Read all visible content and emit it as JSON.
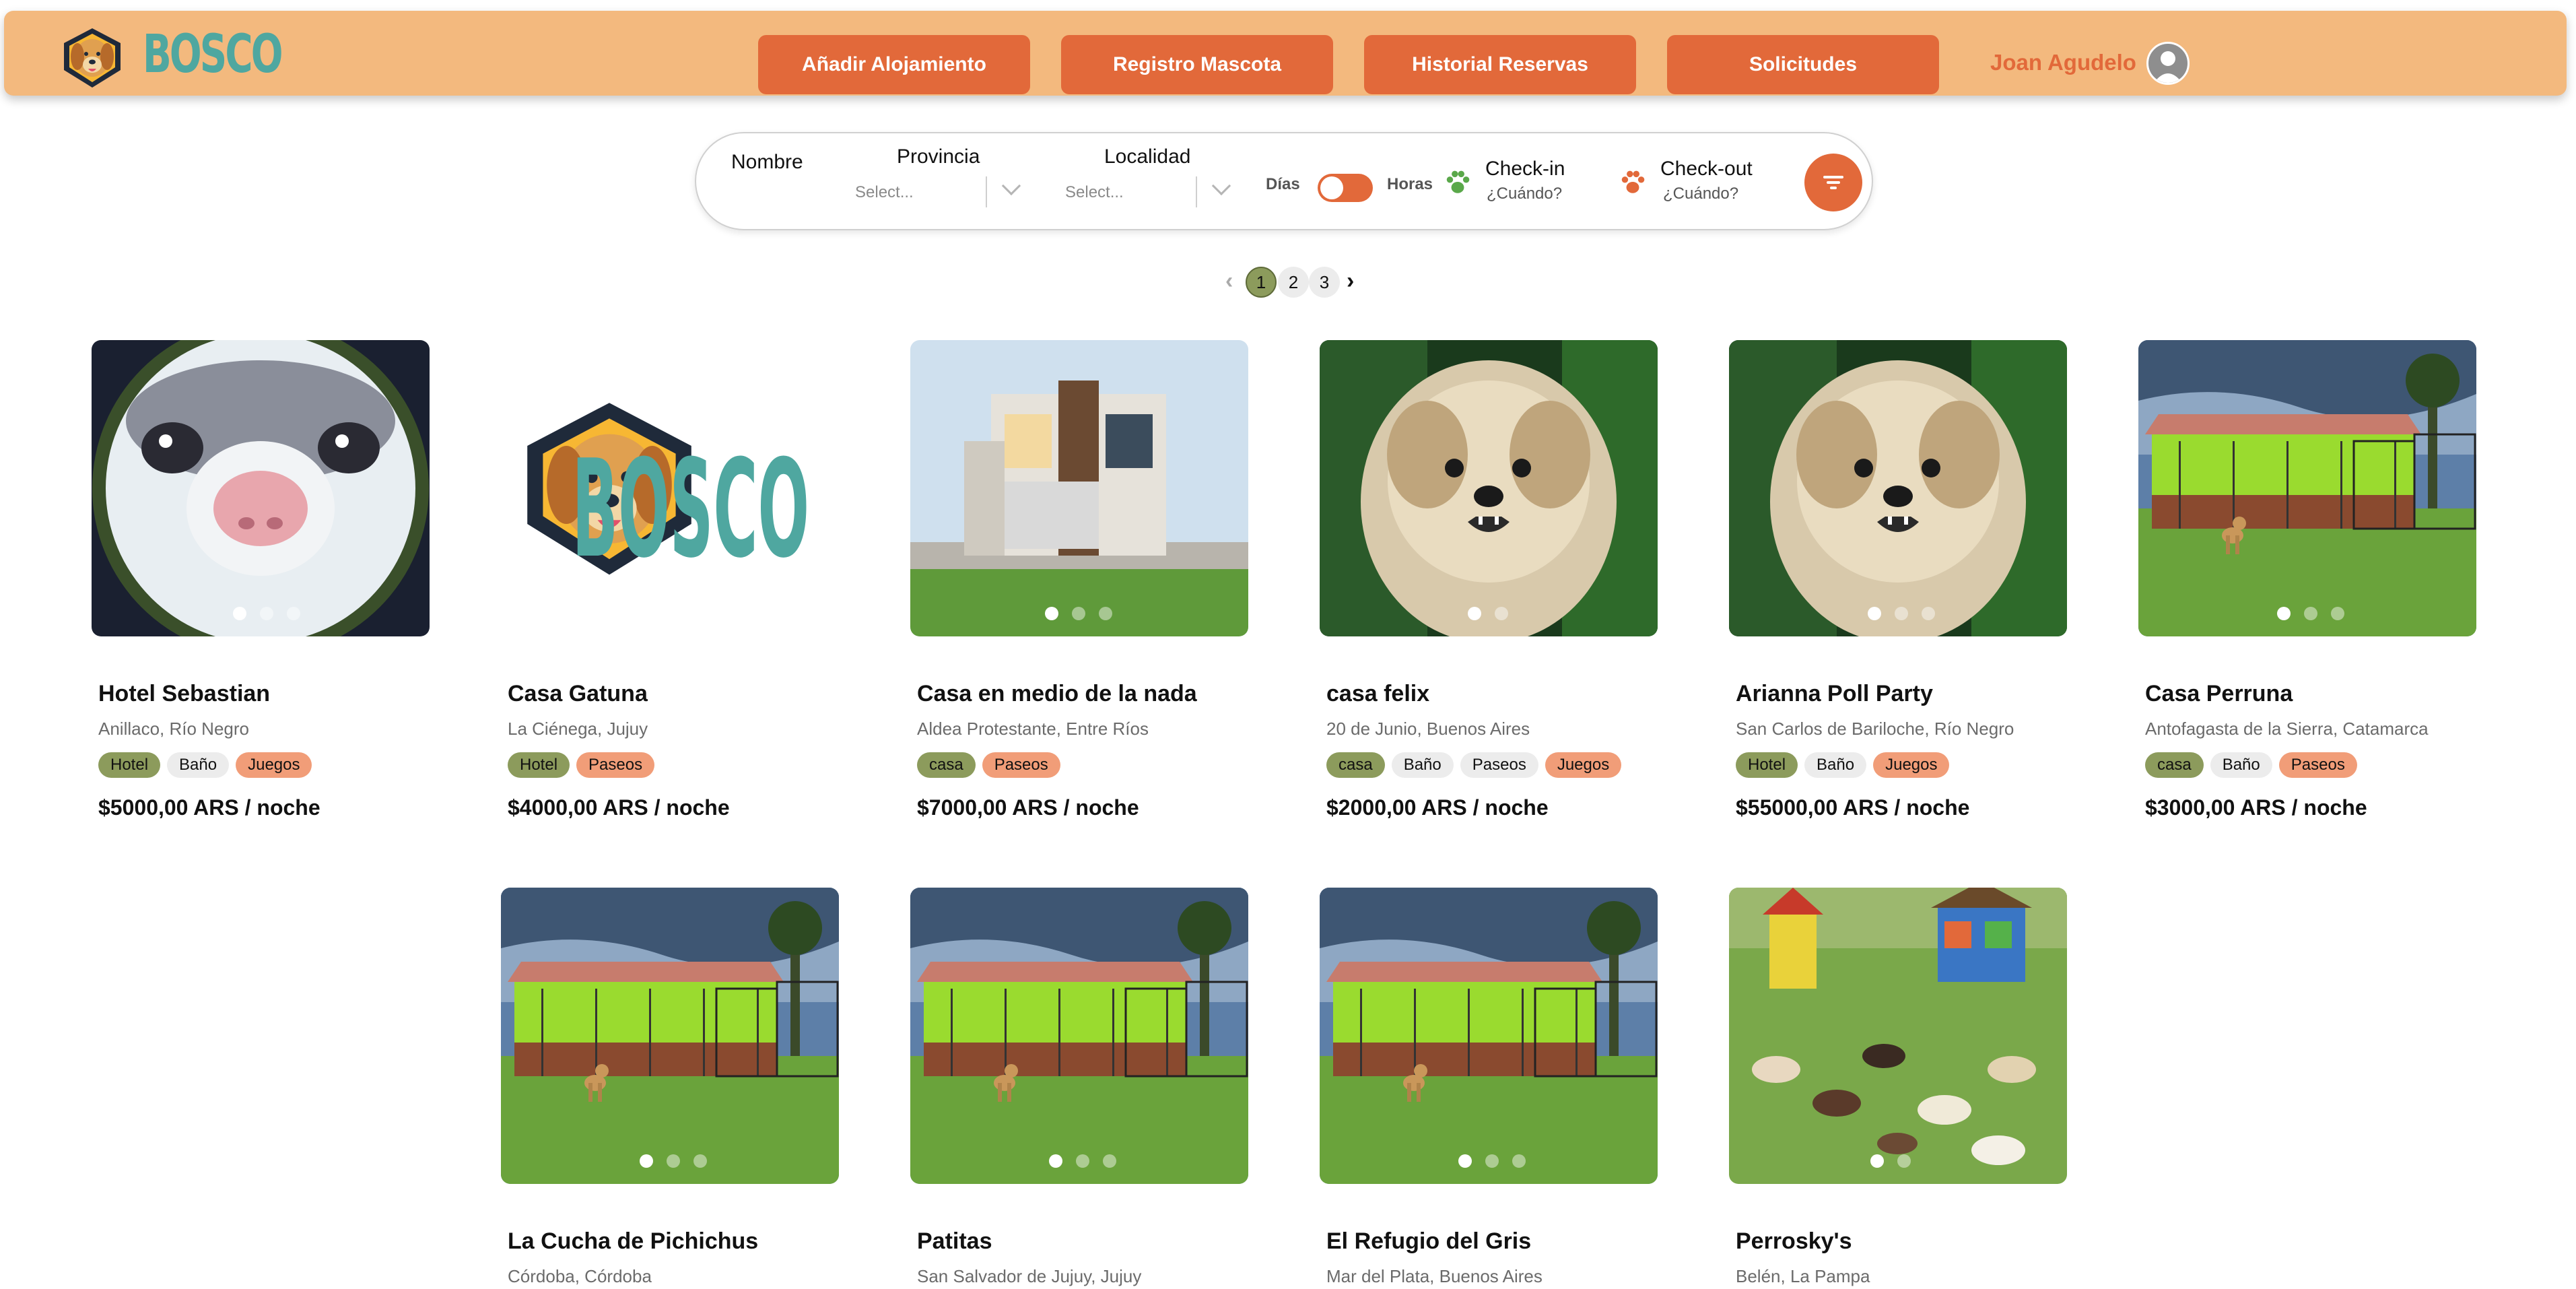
{
  "brand": {
    "name": "BOSCO"
  },
  "nav": {
    "buttons": [
      "Añadir Alojamiento",
      "Registro Mascota",
      "Historial Reservas",
      "Solicitudes"
    ],
    "user_name": "Joan Agudelo"
  },
  "search": {
    "nombre_label": "Nombre",
    "provincia_label": "Provincia",
    "provincia_placeholder": "Select...",
    "localidad_label": "Localidad",
    "localidad_placeholder": "Select...",
    "toggle_left": "Días",
    "toggle_right": "Horas",
    "checkin_label": "Check-in",
    "checkin_value": "¿Cuándo?",
    "checkout_label": "Check-out",
    "checkout_value": "¿Cuándo?"
  },
  "pagination": {
    "pages": [
      "1",
      "2",
      "3"
    ],
    "current": "1"
  },
  "colors": {
    "navbar": "#f3b97e",
    "accent": "#e2693a",
    "brand_teal": "#4fa7a0",
    "olive": "#8c9b5c"
  },
  "listings": [
    {
      "title": "Hotel Sebastian",
      "location": "Anillaco, Río Negro",
      "tags": [
        [
          "Hotel",
          "olive"
        ],
        [
          "Baño",
          "gray"
        ],
        [
          "Juegos",
          "orange"
        ]
      ],
      "price": "$5000,00 ARS / noche",
      "image": "cat-closeup"
    },
    {
      "title": "Casa Gatuna",
      "location": "La Ciénega, Jujuy",
      "tags": [
        [
          "Hotel",
          "olive"
        ],
        [
          "Paseos",
          "orange"
        ]
      ],
      "price": "$4000,00 ARS / noche",
      "image": "bosco-logo"
    },
    {
      "title": "Casa en medio de la nada",
      "location": "Aldea Protestante, Entre Ríos",
      "tags": [
        [
          "casa",
          "olive"
        ],
        [
          "Paseos",
          "orange"
        ]
      ],
      "price": "$7000,00 ARS / noche",
      "image": "modern-house"
    },
    {
      "title": "casa felix",
      "location": "20 de Junio, Buenos Aires",
      "tags": [
        [
          "casa",
          "olive"
        ],
        [
          "Baño",
          "gray"
        ],
        [
          "Paseos",
          "gray"
        ],
        [
          "Juegos",
          "orange"
        ]
      ],
      "price": "$2000,00 ARS / noche",
      "image": "small-dog"
    },
    {
      "title": "Arianna Poll Party",
      "location": "San Carlos de Bariloche, Río Negro",
      "tags": [
        [
          "Hotel",
          "olive"
        ],
        [
          "Baño",
          "gray"
        ],
        [
          "Juegos",
          "orange"
        ]
      ],
      "price": "$55000,00 ARS / noche",
      "image": "small-dog"
    },
    {
      "title": "Casa Perruna",
      "location": "Antofagasta de la Sierra, Catamarca",
      "tags": [
        [
          "casa",
          "olive"
        ],
        [
          "Baño",
          "gray"
        ],
        [
          "Paseos",
          "orange"
        ]
      ],
      "price": "$3000,00 ARS / noche",
      "image": "kennel"
    },
    {
      "title": "La Cucha de Pichichus",
      "location": "Córdoba, Córdoba",
      "tags": [],
      "price": "",
      "image": "kennel"
    },
    {
      "title": "Patitas",
      "location": "San Salvador de Jujuy, Jujuy",
      "tags": [],
      "price": "",
      "image": "kennel"
    },
    {
      "title": "El Refugio del Gris",
      "location": "Mar del Plata, Buenos Aires",
      "tags": [],
      "price": "",
      "image": "kennel"
    },
    {
      "title": "Perrosky's",
      "location": "Belén, La Pampa",
      "tags": [],
      "price": "",
      "image": "dog-park"
    }
  ]
}
